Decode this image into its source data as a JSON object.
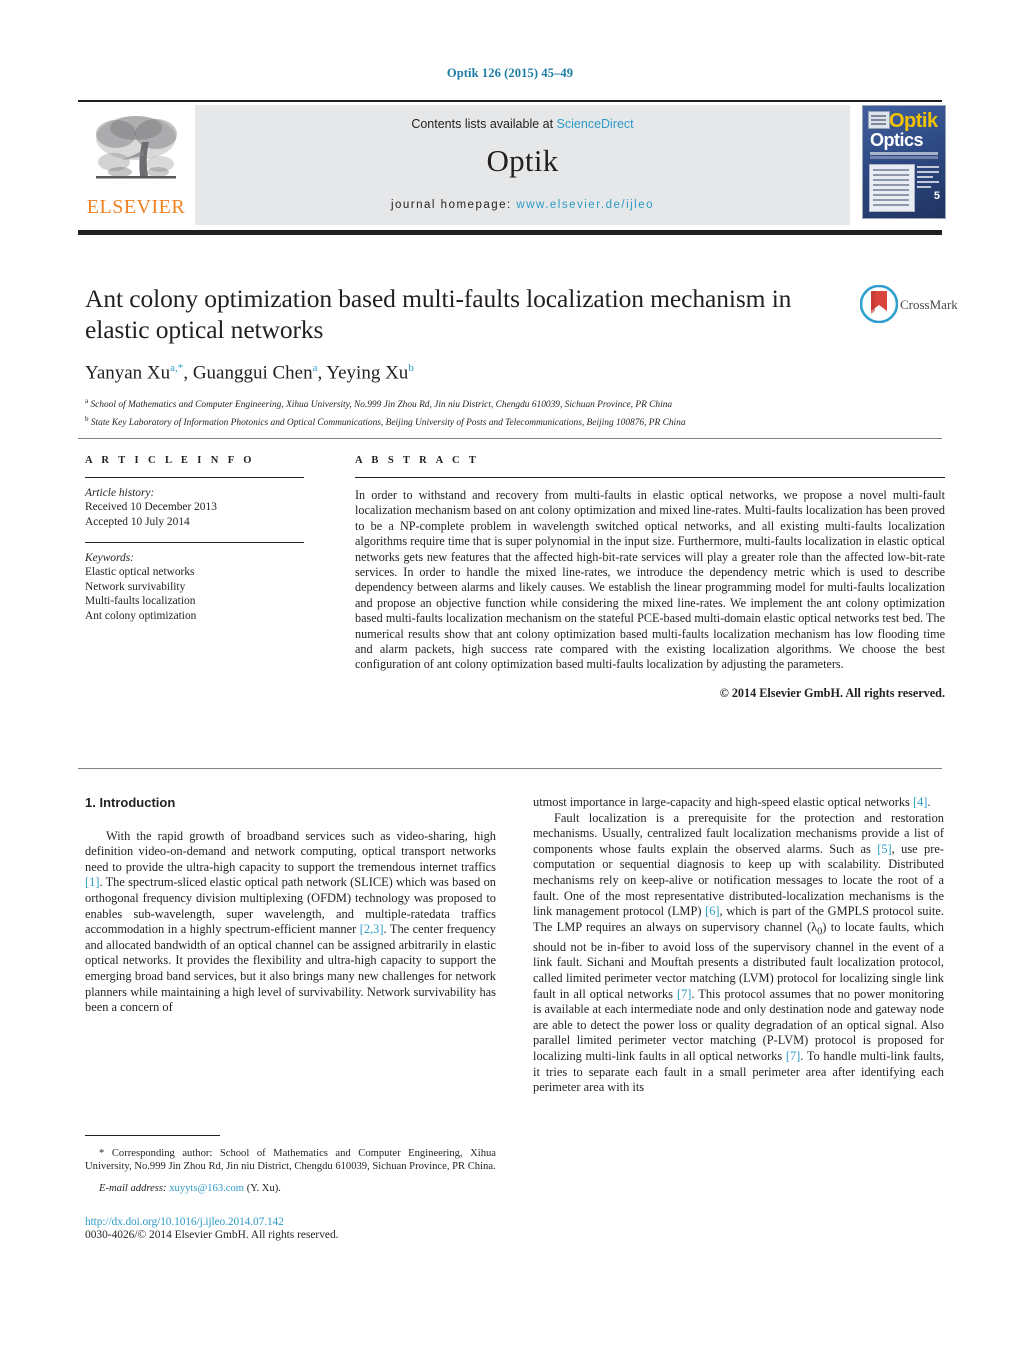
{
  "journal_ref": "Optik 126 (2015) 45–49",
  "masthead": {
    "contents_prefix": "Contents lists available at ",
    "sciencedirect": "ScienceDirect",
    "journal_title": "Optik",
    "homepage_label": "journal homepage:",
    "homepage_url": "www.elsevier.de/ijleo",
    "publisher_wordmark": "ELSEVIER"
  },
  "cover": {
    "title_primary": "Optik",
    "title_secondary": "Optics",
    "issue_number": "5"
  },
  "crossmark": {
    "label": "CrossMark"
  },
  "article": {
    "title": "Ant colony optimization based multi-faults localization mechanism in elastic optical networks",
    "authors_html": "Yanyan Xu<sup>a,*</sup>, Guanggui Chen<sup>a</sup>, Yeying Xu<sup>b</sup>",
    "affiliation_a": "School of Mathematics and Computer Engineering, Xihua University, No.999 Jin Zhou Rd, Jin niu District, Chengdu 610039, Sichuan Province, PR China",
    "affiliation_b": "State Key Laboratory of Information Photonics and Optical Communications, Beijing University of Posts and Telecommunications, Beijing 100876, PR China"
  },
  "article_info": {
    "heading": "A R T I C L E  I N F O",
    "history_label": "Article history:",
    "received": "Received 10 December 2013",
    "accepted": "Accepted 10 July 2014",
    "keywords_label": "Keywords:",
    "keywords": [
      "Elastic optical networks",
      "Network survivability",
      "Multi-faults localization",
      "Ant colony optimization"
    ]
  },
  "abstract": {
    "heading": "A B S T R A C T",
    "body": "In order to withstand and recovery from multi-faults in elastic optical networks, we propose a novel multi-fault localization mechanism based on ant colony optimization and mixed line-rates. Multi-faults localization has been proved to be a NP-complete problem in wavelength switched optical networks, and all existing multi-faults localization algorithms require time that is super polynomial in the input size. Furthermore, multi-faults localization in elastic optical networks gets new features that the affected high-bit-rate services will play a greater role than the affected low-bit-rate services. In order to handle the mixed line-rates, we introduce the dependency metric which is used to describe dependency between alarms and likely causes. We establish the linear programming model for multi-faults localization and propose an objective function while considering the mixed line-rates. We implement the ant colony optimization based multi-faults localization mechanism on the stateful PCE-based multi-domain elastic optical networks test bed. The numerical results show that ant colony optimization based multi-faults localization mechanism has low flooding time and alarm packets, high success rate compared with the existing localization algorithms. We choose the best configuration of ant colony optimization based multi-faults localization by adjusting the parameters.",
    "copyright": "© 2014 Elsevier GmbH. All rights reserved."
  },
  "body": {
    "section_number_title": "1.  Introduction",
    "left_paragraph_1": "With the rapid growth of broadband services such as video-sharing, high definition video-on-demand and network computing, optical transport networks need to provide the ultra-high capacity to support the tremendous internet traffics [1]. The spectrum-sliced elastic optical path network (SLICE) which was based on orthogonal frequency division multiplexing (OFDM) technology was proposed to enables sub-wavelength, super wavelength, and multiple-ratedata traffics accommodation in a highly spectrum-efficient manner [2,3]. The center frequency and allocated bandwidth of an optical channel can be assigned arbitrarily in elastic optical networks. It provides the flexibility and ultra-high capacity to support the emerging broad band services, but it also brings many new challenges for network planners while maintaining a high level of survivability. Network survivability has been a concern of",
    "right_paragraph_1": "utmost importance in large-capacity and high-speed elastic optical networks [4].",
    "right_paragraph_2": "Fault localization is a prerequisite for the protection and restoration mechanisms. Usually, centralized fault localization mechanisms provide a list of components whose faults explain the observed alarms. Such as [5], use pre-computation or sequential diagnosis to keep up with scalability. Distributed mechanisms rely on keep-alive or notification messages to locate the root of a fault. One of the most representative distributed-localization mechanisms is the link management protocol (LMP) [6], which is part of the GMPLS protocol suite. The LMP requires an always on supervisory channel (λ0) to locate faults, which should not be in-fiber to avoid loss of the supervisory channel in the event of a link fault. Sichani and Mouftah presents a distributed fault localization protocol, called limited perimeter vector matching (LVM) protocol for localizing single link fault in all optical networks [7]. This protocol assumes that no power monitoring is available at each intermediate node and only destination node and gateway node are able to detect the power loss or quality degradation of an optical signal. Also parallel limited perimeter vector matching (P-LVM) protocol is proposed for localizing multi-link faults in all optical networks [7]. To handle multi-link faults, it tries to separate each fault in a small perimeter area after identifying each perimeter area with its"
  },
  "footnote": {
    "corresponding": "* Corresponding author: School of Mathematics and Computer Engineering, Xihua University, No.999 Jin Zhou Rd, Jin niu District, Chengdu 610039, Sichuan Province, PR China.",
    "email_label": "E-mail address:",
    "email": "xuyyts@163.com",
    "email_suffix": "(Y. Xu)."
  },
  "footer": {
    "doi": "http://dx.doi.org/10.1016/j.ijleo.2014.07.142",
    "issn_line": "0030-4026/© 2014 Elsevier GmbH. All rights reserved."
  }
}
